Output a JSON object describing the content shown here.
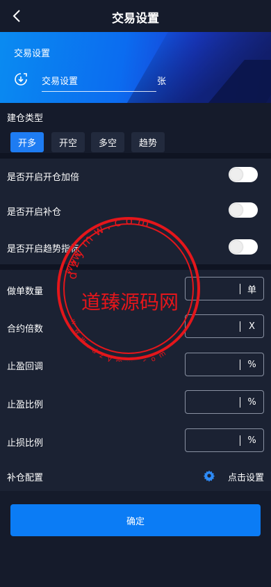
{
  "header": {
    "title": "交易设置"
  },
  "banner": {
    "label": "交易设置",
    "input_value": "交易设置",
    "unit": "张"
  },
  "build_type": {
    "label": "建仓类型",
    "options": [
      "开多",
      "开空",
      "多空",
      "趋势"
    ]
  },
  "toggles": [
    {
      "label": "是否开启开仓加倍"
    },
    {
      "label": "是否开启补仓"
    },
    {
      "label": "是否开启趋势指标"
    }
  ],
  "fields": [
    {
      "label": "做单数量",
      "unit": "单"
    },
    {
      "label": "合约倍数",
      "unit": "X"
    },
    {
      "label": "止盈回调",
      "unit": "%"
    },
    {
      "label": "止盈比例",
      "unit": "%"
    },
    {
      "label": "止损比例",
      "unit": "%"
    }
  ],
  "supplement": {
    "label": "补仓配置",
    "link": "点击设置"
  },
  "confirm_label": "确定",
  "watermark": {
    "text": "道臻源码网",
    "top_text": "dzymw.com",
    "bottom_text": "www.dzymw.com",
    "left_text": "www",
    "color": "#e4161b"
  }
}
